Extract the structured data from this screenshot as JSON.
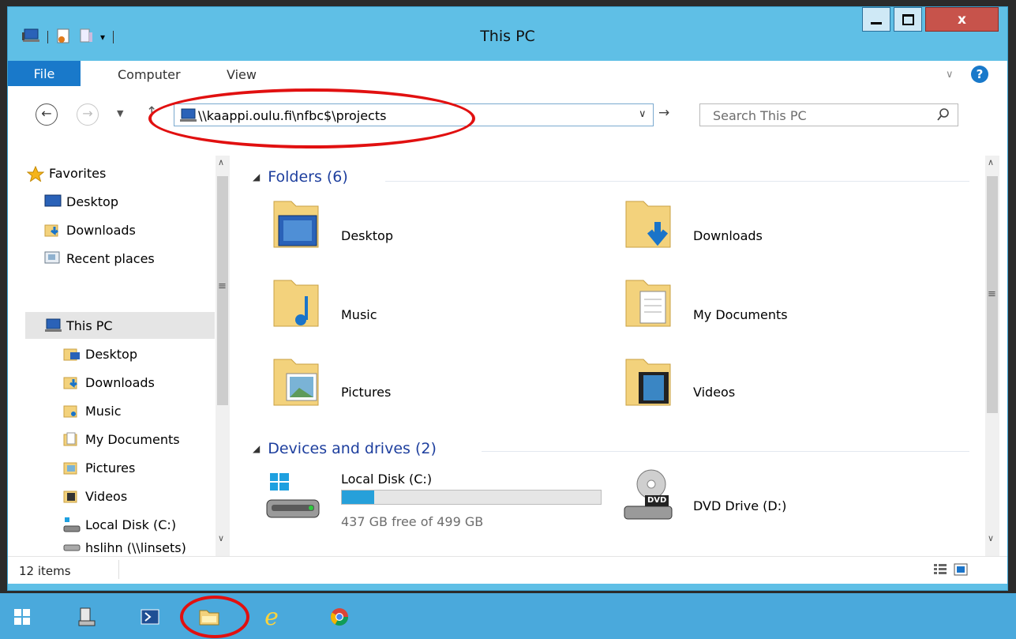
{
  "window": {
    "title": "This PC",
    "controls": {
      "minimize": "—",
      "maximize": "□",
      "close": "x"
    }
  },
  "ribbon": {
    "tabs": [
      "File",
      "Computer",
      "View"
    ],
    "help_icon": "help-icon",
    "expand_icon": "chevron-down-icon"
  },
  "navigation": {
    "address": "\\\\kaappi.oulu.fi\\nfbc$\\projects",
    "search_placeholder": "Search This PC"
  },
  "nav_pane": {
    "favorites": {
      "label": "Favorites",
      "items": [
        "Desktop",
        "Downloads",
        "Recent places"
      ]
    },
    "this_pc": {
      "label": "This PC",
      "items": [
        "Desktop",
        "Downloads",
        "Music",
        "My Documents",
        "Pictures",
        "Videos",
        "Local Disk (C:)",
        "hslihn (\\\\linsets)"
      ]
    }
  },
  "main": {
    "folders_header": "Folders (6)",
    "folders": [
      {
        "name": "Desktop",
        "icon": "desktop-folder-icon"
      },
      {
        "name": "Downloads",
        "icon": "downloads-folder-icon"
      },
      {
        "name": "Music",
        "icon": "music-folder-icon"
      },
      {
        "name": "My Documents",
        "icon": "documents-folder-icon"
      },
      {
        "name": "Pictures",
        "icon": "pictures-folder-icon"
      },
      {
        "name": "Videos",
        "icon": "videos-folder-icon"
      }
    ],
    "devices_header": "Devices and drives (2)",
    "devices": [
      {
        "name": "Local Disk (C:)",
        "free_text": "437 GB free of 499 GB",
        "used_fraction": 0.124,
        "icon": "local-disk-icon"
      },
      {
        "name": "DVD Drive (D:)",
        "icon": "dvd-drive-icon",
        "badge": "DVD"
      }
    ]
  },
  "status": {
    "item_count": "12 items"
  },
  "colors": {
    "accent": "#1979ca",
    "titlebar": "#5fbfe6",
    "close": "#c7534b",
    "taskbar": "#4aa9dc",
    "header_text": "#1e3f9e",
    "annotation": "#e11010",
    "disk_bar": "#26a0da"
  },
  "taskbar": {
    "icons": [
      "windows-start-icon",
      "server-manager-icon",
      "powershell-icon",
      "file-explorer-icon",
      "internet-explorer-icon",
      "chrome-icon"
    ]
  }
}
